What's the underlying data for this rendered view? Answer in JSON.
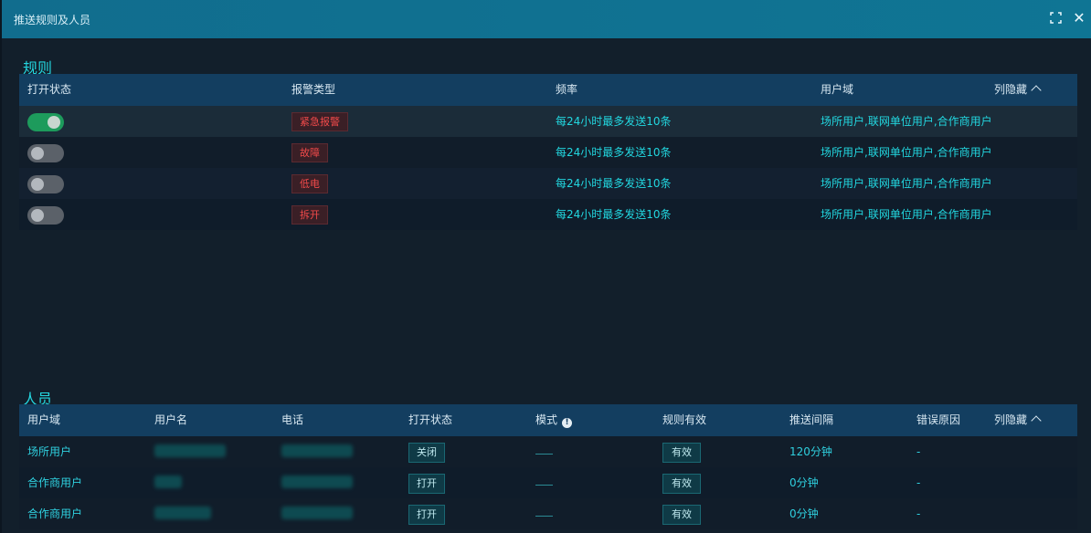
{
  "window": {
    "title": "推送规则及人员"
  },
  "rules": {
    "section_title": "规则",
    "columns": [
      "打开状态",
      "报警类型",
      "频率",
      "用户域"
    ],
    "column_hide_label": "列隐藏",
    "rows": [
      {
        "enabled": true,
        "alarm_type": "紧急报警",
        "frequency": "每24小时最多发送10条",
        "domain": "场所用户,联网单位用户,合作商用户"
      },
      {
        "enabled": false,
        "alarm_type": "故障",
        "frequency": "每24小时最多发送10条",
        "domain": "场所用户,联网单位用户,合作商用户"
      },
      {
        "enabled": false,
        "alarm_type": "低电",
        "frequency": "每24小时最多发送10条",
        "domain": "场所用户,联网单位用户,合作商用户"
      },
      {
        "enabled": false,
        "alarm_type": "拆开",
        "frequency": "每24小时最多发送10条",
        "domain": "场所用户,联网单位用户,合作商用户"
      }
    ]
  },
  "people": {
    "section_title": "人员",
    "columns": [
      "用户域",
      "用户名",
      "电话",
      "打开状态",
      "模式",
      "规则有效",
      "推送间隔",
      "错误原因"
    ],
    "mode_info_icon": "info-icon",
    "column_hide_label": "列隐藏",
    "rows": [
      {
        "domain": "场所用户",
        "username": "13????????",
        "phone": "",
        "status_btn": "关闭",
        "mode": "",
        "rule_valid": "有效",
        "interval": "120分钟",
        "error": "-"
      },
      {
        "domain": "合作商用户",
        "username": "",
        "phone": "1?????76267",
        "status_btn": "打开",
        "mode": "",
        "rule_valid": "有效",
        "interval": "0分钟",
        "error": "-"
      },
      {
        "domain": "合作商用户",
        "username": "",
        "phone": "1??7??????59",
        "status_btn": "打开",
        "mode": "",
        "rule_valid": "有效",
        "interval": "0分钟",
        "error": "-"
      }
    ]
  },
  "colors": {
    "title_bar": "#116d8e",
    "accent_cyan": "#22d7e0",
    "header_bg": "#133e60",
    "toggle_on": "#1d9b5c",
    "alarm_red": "#f14a4a"
  },
  "icons": {
    "fullscreen": "fullscreen-icon",
    "close": "close-icon",
    "collapse": "chevron-up-icon"
  }
}
